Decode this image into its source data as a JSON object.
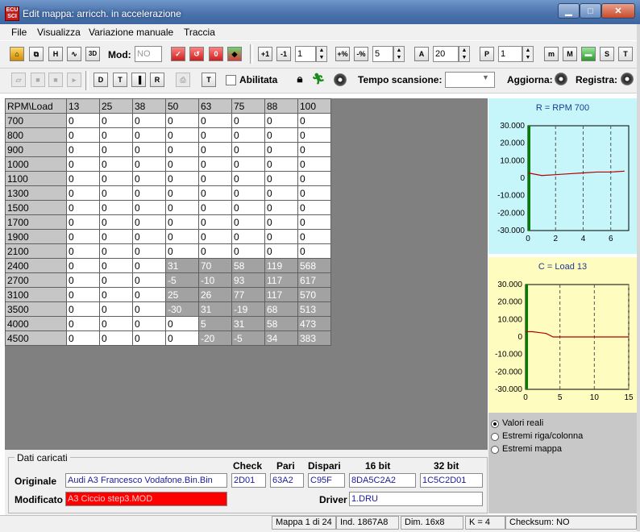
{
  "window": {
    "title": "Edit mappa: arricch. in accelerazione",
    "app_icon_text": "ECU SCI"
  },
  "menu": [
    "File",
    "Visualizza",
    "Variazione manuale",
    "Traccia"
  ],
  "toolbar1": {
    "mod_label": "Mod:",
    "mod_value": "NO",
    "spin1": "1",
    "spin2": "5",
    "spin3": "20",
    "spin4": "1"
  },
  "toolbar2": {
    "abilitata_label": "Abilitata",
    "tempo_label": "Tempo scansione:",
    "aggiorna_label": "Aggiorna:",
    "registra_label": "Registra:"
  },
  "grid": {
    "corner": "RPM\\Load",
    "columns": [
      "13",
      "25",
      "38",
      "50",
      "63",
      "75",
      "88",
      "100"
    ],
    "rows": [
      {
        "rpm": "700",
        "values": [
          "0",
          "0",
          "0",
          "0",
          "0",
          "0",
          "0",
          "0"
        ]
      },
      {
        "rpm": "800",
        "values": [
          "0",
          "0",
          "0",
          "0",
          "0",
          "0",
          "0",
          "0"
        ]
      },
      {
        "rpm": "900",
        "values": [
          "0",
          "0",
          "0",
          "0",
          "0",
          "0",
          "0",
          "0"
        ]
      },
      {
        "rpm": "1000",
        "values": [
          "0",
          "0",
          "0",
          "0",
          "0",
          "0",
          "0",
          "0"
        ]
      },
      {
        "rpm": "1100",
        "values": [
          "0",
          "0",
          "0",
          "0",
          "0",
          "0",
          "0",
          "0"
        ]
      },
      {
        "rpm": "1300",
        "values": [
          "0",
          "0",
          "0",
          "0",
          "0",
          "0",
          "0",
          "0"
        ]
      },
      {
        "rpm": "1500",
        "values": [
          "0",
          "0",
          "0",
          "0",
          "0",
          "0",
          "0",
          "0"
        ]
      },
      {
        "rpm": "1700",
        "values": [
          "0",
          "0",
          "0",
          "0",
          "0",
          "0",
          "0",
          "0"
        ]
      },
      {
        "rpm": "1900",
        "values": [
          "0",
          "0",
          "0",
          "0",
          "0",
          "0",
          "0",
          "0"
        ]
      },
      {
        "rpm": "2100",
        "values": [
          "0",
          "0",
          "0",
          "0",
          "0",
          "0",
          "0",
          "0"
        ]
      },
      {
        "rpm": "2400",
        "values": [
          "0",
          "0",
          "0",
          "31",
          "70",
          "58",
          "119",
          "568"
        ]
      },
      {
        "rpm": "2700",
        "values": [
          "0",
          "0",
          "0",
          "-5",
          "-10",
          "93",
          "117",
          "617"
        ]
      },
      {
        "rpm": "3100",
        "values": [
          "0",
          "0",
          "0",
          "25",
          "26",
          "77",
          "117",
          "570"
        ]
      },
      {
        "rpm": "3500",
        "values": [
          "0",
          "0",
          "0",
          "-30",
          "31",
          "-19",
          "68",
          "513"
        ]
      },
      {
        "rpm": "4000",
        "values": [
          "0",
          "0",
          "0",
          "0",
          "5",
          "31",
          "58",
          "473"
        ]
      },
      {
        "rpm": "4500",
        "values": [
          "0",
          "0",
          "0",
          "0",
          "-20",
          "-5",
          "34",
          "383"
        ]
      }
    ],
    "highlight": [
      [
        0,
        0,
        0,
        0,
        0,
        0,
        0,
        0
      ],
      [
        0,
        0,
        0,
        0,
        0,
        0,
        0,
        0
      ],
      [
        0,
        0,
        0,
        0,
        0,
        0,
        0,
        0
      ],
      [
        0,
        0,
        0,
        0,
        0,
        0,
        0,
        0
      ],
      [
        0,
        0,
        0,
        0,
        0,
        0,
        0,
        0
      ],
      [
        0,
        0,
        0,
        0,
        0,
        0,
        0,
        0
      ],
      [
        0,
        0,
        0,
        0,
        0,
        0,
        0,
        0
      ],
      [
        0,
        0,
        0,
        0,
        0,
        0,
        0,
        0
      ],
      [
        0,
        0,
        0,
        0,
        0,
        0,
        0,
        0
      ],
      [
        0,
        0,
        0,
        0,
        0,
        0,
        0,
        0
      ],
      [
        0,
        0,
        0,
        1,
        1,
        1,
        1,
        1
      ],
      [
        0,
        0,
        0,
        1,
        1,
        1,
        1,
        1
      ],
      [
        0,
        0,
        0,
        1,
        1,
        1,
        1,
        1
      ],
      [
        0,
        0,
        0,
        1,
        1,
        1,
        1,
        1
      ],
      [
        0,
        0,
        0,
        0,
        1,
        1,
        1,
        1
      ],
      [
        0,
        0,
        0,
        0,
        1,
        1,
        1,
        1
      ]
    ]
  },
  "side_charts": [
    {
      "title": "R = RPM 700",
      "yticks": [
        "30.000",
        "20.000",
        "10.000",
        "0",
        "-10.000",
        "-20.000",
        "-30.000"
      ],
      "xticks": [
        "0",
        "2",
        "4",
        "6"
      ]
    },
    {
      "title": "C = Load 13",
      "yticks": [
        "30.000",
        "20.000",
        "10.000",
        "0",
        "-10.000",
        "-20.000",
        "-30.000"
      ],
      "xticks": [
        "0",
        "5",
        "10",
        "15"
      ]
    }
  ],
  "chart_data": [
    {
      "type": "line",
      "title": "R = RPM 700",
      "x": [
        0,
        1,
        2,
        3,
        4,
        5,
        6,
        7
      ],
      "series": [
        {
          "values": [
            3000,
            1500,
            2000,
            2500,
            3000,
            3500,
            3500,
            4000
          ]
        }
      ],
      "ylim": [
        -30000,
        30000
      ],
      "xlim": [
        0,
        7.3
      ],
      "grid": "dashed-vertical"
    },
    {
      "type": "line",
      "title": "C = Load 13",
      "x": [
        0,
        1,
        2,
        3,
        4,
        5,
        6,
        7,
        8,
        9,
        10,
        11,
        12,
        13,
        14,
        15
      ],
      "series": [
        {
          "values": [
            3000,
            3000,
            2500,
            2000,
            0,
            0,
            0,
            0,
            0,
            0,
            0,
            0,
            0,
            0,
            0,
            0
          ]
        }
      ],
      "ylim": [
        -30000,
        30000
      ],
      "xlim": [
        0,
        15
      ],
      "grid": "dashed-vertical"
    }
  ],
  "view_options": {
    "items": [
      "Valori reali",
      "Estremi riga/colonna",
      "Estremi mappa"
    ],
    "selected": 0
  },
  "dati": {
    "legend": "Dati caricati",
    "headers": {
      "check": "Check",
      "pari": "Pari",
      "dispari": "Dispari",
      "b16": "16 bit",
      "b32": "32 bit"
    },
    "originale_label": "Originale",
    "originale_file": "Audi A3 Francesco Vodafone.Bin.Bin",
    "check": "2D01",
    "pari": "63A2",
    "dispari": "C95F",
    "b16": "8DA5C2A2",
    "b32": "1C5C2D01",
    "modificato_label": "Modificato",
    "modificato_file": "A3 Ciccio step3.MOD",
    "driver_label": "Driver",
    "driver_value": "1.DRU"
  },
  "status": {
    "mappa": "Mappa 1 di 24",
    "ind": "Ind. 1867A8",
    "dim": "Dim. 16x8",
    "k": "K = 4",
    "checksum": "Checksum: NO"
  },
  "colors": {
    "title_bar": "#4b74ad",
    "grid_header": "#c6c6c6",
    "grid_highlight": "#a2a2a2",
    "chart1_bg": "#c6f6fa",
    "chart2_bg": "#fffcbf",
    "chart_line": "#b00000",
    "chart_axis_bar": "#008000",
    "modificato_bg": "#ff0000"
  }
}
